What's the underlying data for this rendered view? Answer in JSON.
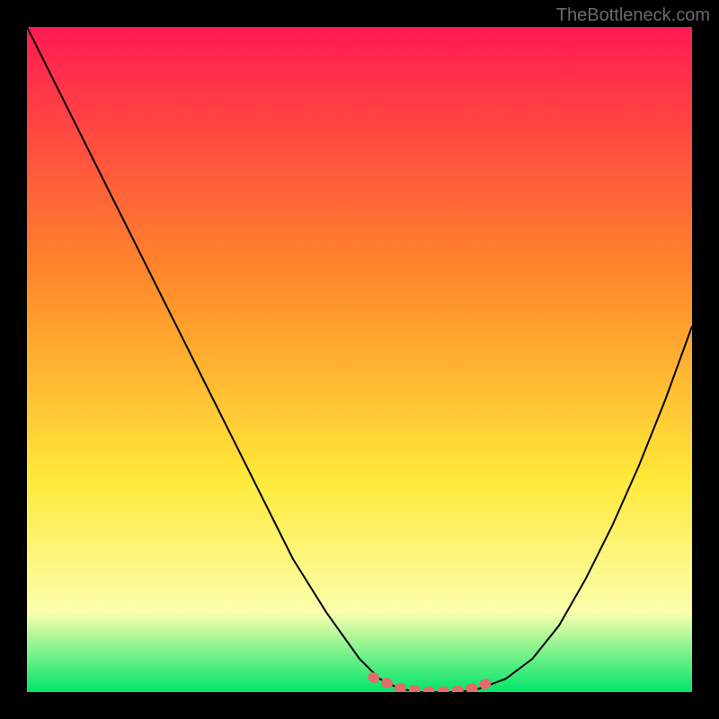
{
  "attribution": "TheBottleneck.com",
  "colors": {
    "bg": "#000000",
    "grad_top": "#ff1a52",
    "grad_mid1": "#ff8a2a",
    "grad_mid2": "#ffe93a",
    "grad_mid3": "#fbffad",
    "grad_bottom": "#00e56a",
    "curve": "#000000",
    "highlight": "#e26b6b"
  },
  "chart_data": {
    "type": "line",
    "title": "",
    "xlabel": "",
    "ylabel": "",
    "xlim": [
      0,
      100
    ],
    "ylim": [
      0,
      100
    ],
    "series": [
      {
        "name": "bottleneck-curve",
        "x": [
          0,
          5,
          10,
          15,
          20,
          25,
          30,
          35,
          40,
          45,
          50,
          53,
          56,
          59,
          62,
          65,
          68,
          72,
          76,
          80,
          84,
          88,
          92,
          96,
          100
        ],
        "y": [
          100,
          90,
          80,
          70,
          60,
          50,
          40,
          30,
          20,
          12,
          5,
          2,
          0.5,
          0,
          0,
          0,
          0.5,
          2,
          5,
          10,
          17,
          25,
          34,
          44,
          55
        ]
      },
      {
        "name": "highlight-segment",
        "x": [
          52,
          56,
          60,
          64,
          68,
          70
        ],
        "y": [
          2.2,
          0.6,
          0.1,
          0.1,
          0.7,
          1.8
        ]
      }
    ]
  }
}
